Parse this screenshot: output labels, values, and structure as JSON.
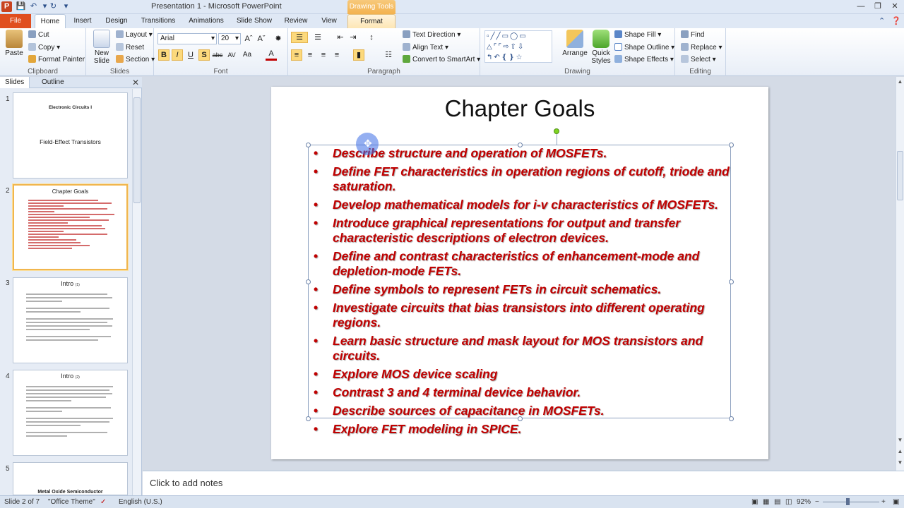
{
  "window": {
    "title": "Presentation 1 - Microsoft PowerPoint",
    "contextual_tab_group": "Drawing Tools",
    "app_icon_letter": "P"
  },
  "tabs": [
    {
      "label": "File"
    },
    {
      "label": "Home"
    },
    {
      "label": "Insert"
    },
    {
      "label": "Design"
    },
    {
      "label": "Transitions"
    },
    {
      "label": "Animations"
    },
    {
      "label": "Slide Show"
    },
    {
      "label": "Review"
    },
    {
      "label": "View"
    },
    {
      "label": "Format"
    }
  ],
  "ribbon": {
    "clipboard": {
      "paste": "Paste",
      "cut": "Cut",
      "copy": "Copy",
      "format_painter": "Format Painter",
      "label": "Clipboard"
    },
    "slides": {
      "new_slide": "New Slide",
      "layout": "Layout",
      "reset": "Reset",
      "section": "Section",
      "label": "Slides"
    },
    "font": {
      "family": "Arial",
      "size": "20",
      "label": "Font"
    },
    "paragraph": {
      "text_direction": "Text Direction",
      "align_text": "Align Text",
      "convert_smartart": "Convert to SmartArt",
      "label": "Paragraph"
    },
    "drawing": {
      "arrange": "Arrange",
      "quick_styles": "Quick Styles",
      "shape_fill": "Shape Fill",
      "shape_outline": "Shape Outline",
      "shape_effects": "Shape Effects",
      "label": "Drawing"
    },
    "editing": {
      "find": "Find",
      "replace": "Replace",
      "select": "Select",
      "label": "Editing"
    }
  },
  "panel": {
    "tab_slides": "Slides",
    "tab_outline": "Outline",
    "thumbnails": [
      {
        "num": "1",
        "title": "Electronic Circuits I",
        "subtitle": "Field-Effect Transistors"
      },
      {
        "num": "2",
        "title": "Chapter Goals"
      },
      {
        "num": "3",
        "title": "Intro",
        "badge": "(1)"
      },
      {
        "num": "4",
        "title": "Intro",
        "badge": "(2)"
      },
      {
        "num": "5",
        "title": "Metal Oxide Semiconductor"
      }
    ]
  },
  "slide": {
    "title": "Chapter Goals",
    "bullets": [
      "Describe structure and operation of MOSFETs.",
      "Define FET characteristics in operation regions of cutoff, triode and saturation.",
      "Develop mathematical models for i-v characteristics of MOSFETs.",
      "Introduce graphical representations for output and transfer characteristic descriptions of electron devices.",
      "Define and contrast characteristics of enhancement-mode and depletion-mode FETs.",
      "Define symbols to represent FETs in circuit schematics.",
      "Investigate circuits that bias transistors into different operating regions.",
      "Learn basic structure and mask layout for MOS transistors and circuits.",
      "Explore MOS device scaling",
      "Contrast 3 and 4 terminal device behavior.",
      "Describe sources of capacitance in MOSFETs.",
      "Explore FET modeling in SPICE."
    ]
  },
  "notes": {
    "placeholder": "Click to add notes"
  },
  "status": {
    "slide_of": "Slide 2 of 7",
    "theme": "\"Office Theme\"",
    "language": "English (U.S.)",
    "zoom": "92%"
  },
  "colors": {
    "bullet_text": "#c00000",
    "file_tab": "#e04e1f",
    "selection": "#f1b64d"
  }
}
